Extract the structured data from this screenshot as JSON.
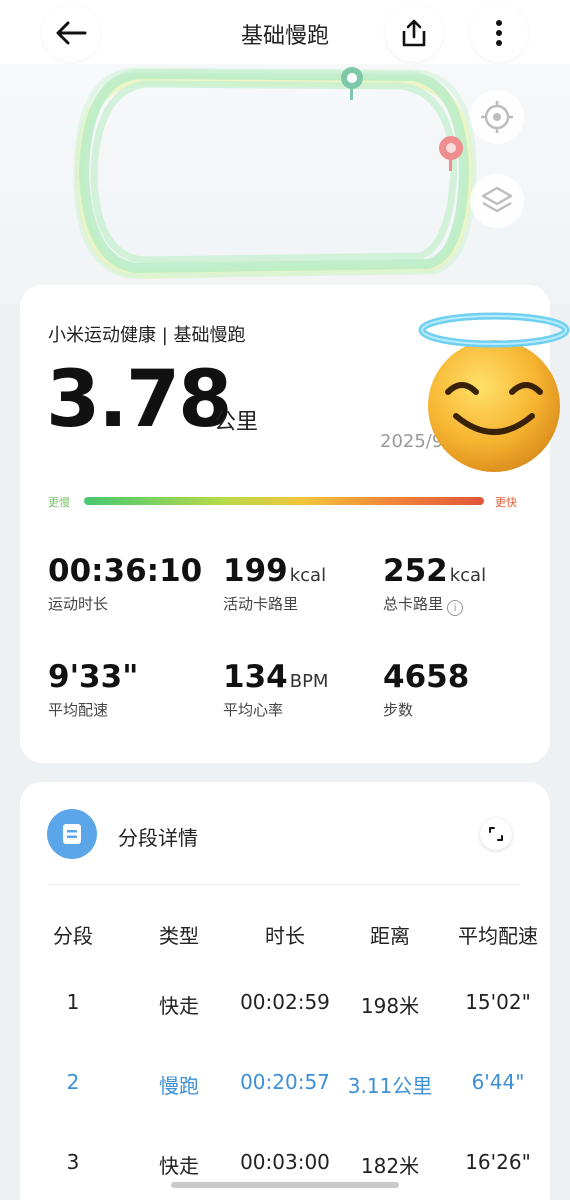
{
  "header": {
    "title": "基础慢跑"
  },
  "summary": {
    "source_title": "小米运动健康 | 基础慢跑",
    "distance": "3.78",
    "distance_unit": "公里",
    "date": "2025/9/",
    "pace_scale": {
      "slow_label": "更慢",
      "fast_label": "更快"
    },
    "stats": [
      {
        "value": "00:36:10",
        "unit": "",
        "label": "运动时长"
      },
      {
        "value": "199",
        "unit": "kcal",
        "label": "活动卡路里"
      },
      {
        "value": "252",
        "unit": "kcal",
        "label": "总卡路里"
      },
      {
        "value": "9'33\"",
        "unit": "",
        "label": "平均配速"
      },
      {
        "value": "134",
        "unit": "BPM",
        "label": "平均心率"
      },
      {
        "value": "4658",
        "unit": "",
        "label": "步数"
      }
    ]
  },
  "segments": {
    "title": "分段详情",
    "columns": [
      "分段",
      "类型",
      "时长",
      "距离",
      "平均配速"
    ],
    "rows": [
      {
        "cells": [
          "1",
          "快走",
          "00:02:59",
          "198米",
          "15'02\""
        ],
        "highlight": false
      },
      {
        "cells": [
          "2",
          "慢跑",
          "00:20:57",
          "3.11公里",
          "6'44\""
        ],
        "highlight": true
      },
      {
        "cells": [
          "3",
          "快走",
          "00:03:00",
          "182米",
          "16'26\""
        ],
        "highlight": false
      }
    ]
  },
  "colors": {
    "accent_blue": "#3d8fd6",
    "segment_icon": "#5aa6e8",
    "route_green": "#b9ecc6",
    "start_marker": "#7fc8a9",
    "end_marker": "#ef8e8e"
  },
  "icons": {
    "back": "arrow-left-icon",
    "share": "share-icon",
    "more": "more-vertical-icon",
    "locate": "target-icon",
    "layers": "layers-icon",
    "segment": "list-icon",
    "expand": "expand-icon",
    "overlay": "smiling-face-with-halo-emoji",
    "info": "info-icon"
  }
}
